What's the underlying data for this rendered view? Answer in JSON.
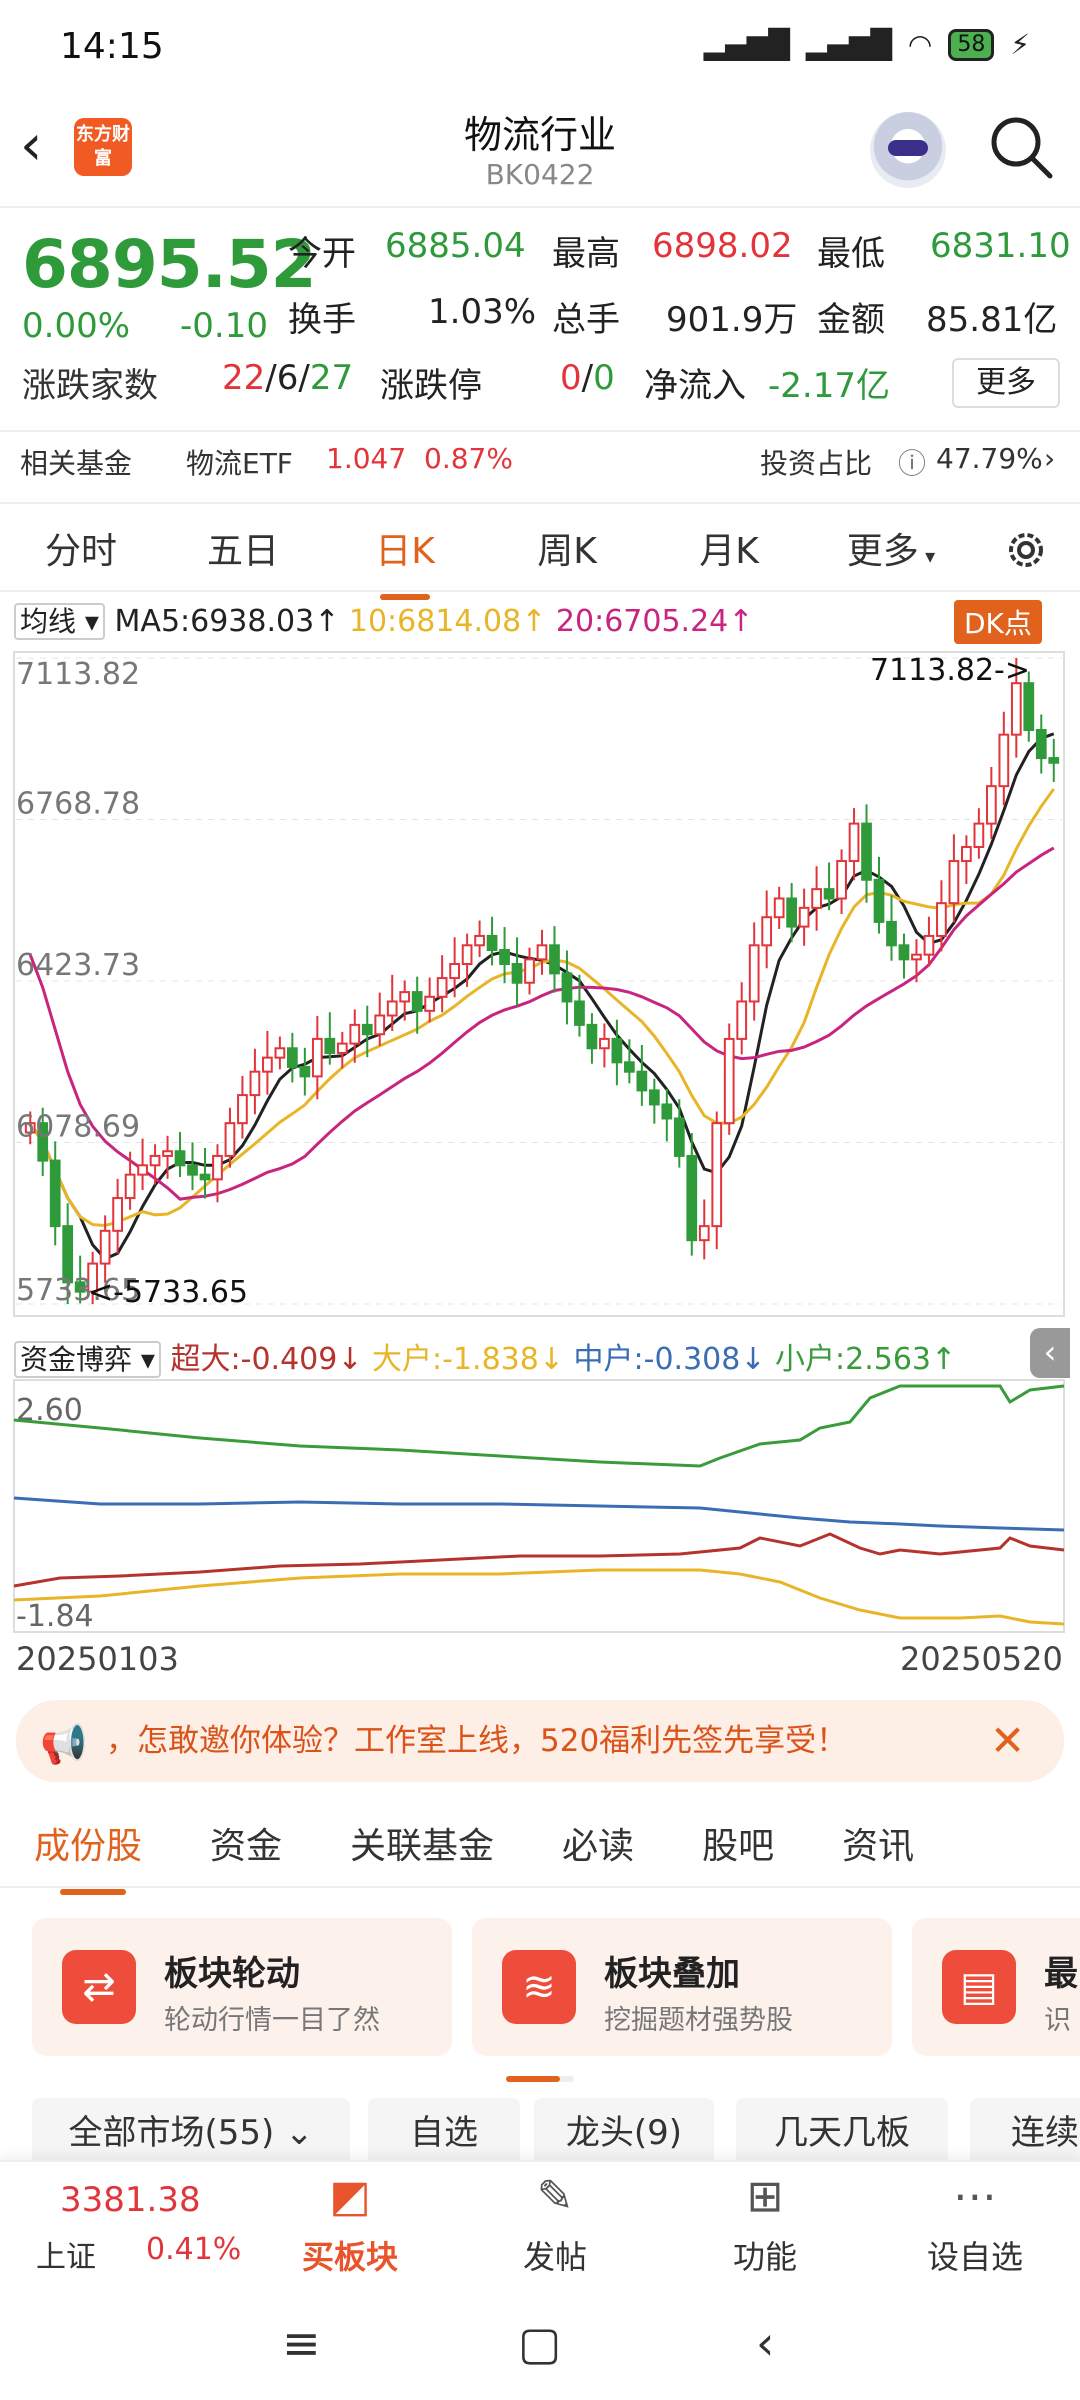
{
  "status_bar": {
    "time": "14:15",
    "battery": "58"
  },
  "header": {
    "logo_text": "东方财富",
    "title": "物流行业",
    "code": "BK0422"
  },
  "quote": {
    "price": "6895.52",
    "pct": "0.00%",
    "change": "-0.10",
    "open_label": "今开",
    "open": "6885.04",
    "high_label": "最高",
    "high": "6898.02",
    "low_label": "最低",
    "low": "6831.10",
    "turnover_label": "换手",
    "turnover": "1.03%",
    "volume_label": "总手",
    "volume": "901.9万",
    "amount_label": "金额",
    "amount": "85.81亿",
    "updown_label": "涨跌家数",
    "up": "22",
    "flat": "6",
    "down": "27",
    "limit_label": "涨跌停",
    "limit_up": "0",
    "limit_down": "0",
    "netflow_label": "净流入",
    "netflow": "-2.17亿",
    "more_label": "更多"
  },
  "fund": {
    "label": "相关基金",
    "name": "物流ETF",
    "price": "1.047",
    "pct": "0.87%",
    "ratio_label": "投资占比",
    "ratio": "47.79%"
  },
  "period_tabs": [
    "分时",
    "五日",
    "日K",
    "周K",
    "月K",
    "更多"
  ],
  "ma": {
    "selector": "均线",
    "ma5": "MA5:6938.03↑",
    "ma10": "10:6814.08↑",
    "ma20": "20:6705.24↑",
    "dk": "DK点"
  },
  "chart_data": {
    "type": "candlestick",
    "y_ticks": [
      "7113.82",
      "6768.78",
      "6423.73",
      "6078.69",
      "5733.65"
    ],
    "ylim": [
      5733.65,
      7113.82
    ],
    "high_annotation": "7113.82->",
    "low_annotation": "<-5733.65",
    "date_start": "20250103",
    "date_end": "20250520",
    "close": [
      6120,
      6040,
      5900,
      5780,
      5760,
      5820,
      5890,
      5960,
      6010,
      6030,
      6050,
      6060,
      6030,
      6010,
      6000,
      6050,
      6120,
      6180,
      6230,
      6260,
      6280,
      6240,
      6220,
      6300,
      6270,
      6290,
      6330,
      6310,
      6350,
      6380,
      6400,
      6360,
      6390,
      6430,
      6460,
      6500,
      6520,
      6490,
      6460,
      6420,
      6470,
      6500,
      6440,
      6380,
      6330,
      6280,
      6300,
      6250,
      6230,
      6190,
      6160,
      6130,
      6050,
      5870,
      5900,
      6120,
      6300,
      6380,
      6500,
      6560,
      6600,
      6540,
      6580,
      6620,
      6600,
      6680,
      6760,
      6640,
      6550,
      6500,
      6470,
      6480,
      6520,
      6590,
      6680,
      6710,
      6760,
      6840,
      6950,
      7060,
      6960,
      6900,
      6890
    ],
    "ma5_label": "MA5",
    "ma10_label": "10",
    "ma20_label": "20"
  },
  "fund_flow": {
    "selector": "资金博弈",
    "super": "超大:-0.409↓",
    "large": "大户:-1.838↓",
    "mid": "中户:-0.308↓",
    "small": "小户:2.563↑",
    "ymax": "2.60",
    "ymin": "-1.84"
  },
  "banner": {
    "text": "，怎敢邀你体验？工作室上线，520福利先签先享受！"
  },
  "section_tabs": [
    "成份股",
    "资金",
    "关联基金",
    "必读",
    "股吧",
    "资讯"
  ],
  "cards": [
    {
      "title": "板块轮动",
      "subtitle": "轮动行情一目了然"
    },
    {
      "title": "板块叠加",
      "subtitle": "挖掘题材强势股"
    },
    {
      "title": "最",
      "subtitle": "识"
    }
  ],
  "filters": [
    "全部市场(55)",
    "自选",
    "龙头(9)",
    "几天几板",
    "连续"
  ],
  "bottom": {
    "index_value": "3381.38",
    "index_name": "上证",
    "index_pct": "0.41%",
    "buy": "买板块",
    "post": "发帖",
    "func": "功能",
    "watch": "设自选"
  },
  "colors": {
    "accent": "#e0621c",
    "up": "#e2343b",
    "down": "#2e9a3a"
  }
}
